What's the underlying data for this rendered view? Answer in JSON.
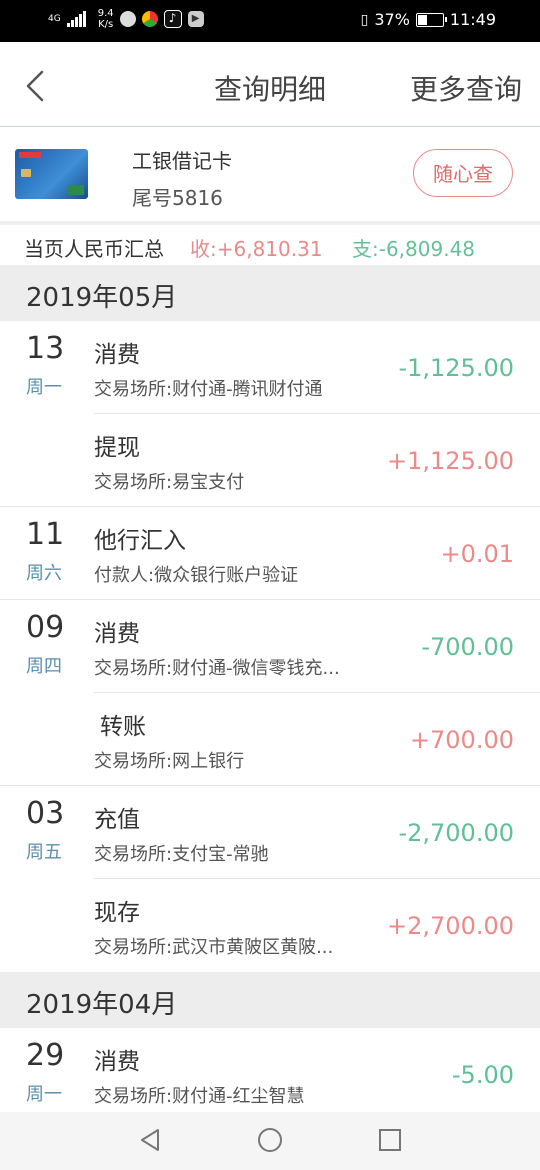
{
  "status": {
    "network": "4G",
    "speed_value": "9.4",
    "speed_unit": "K/s",
    "battery": "37%",
    "time": "11:49",
    "app_icons": [
      "wechat-icon",
      "browser-icon",
      "tiktok-icon",
      "video-icon"
    ]
  },
  "nav": {
    "title": "查询明细",
    "more": "更多查询"
  },
  "card": {
    "name": "工银借记卡",
    "tail": "尾号5816",
    "button": "随心查"
  },
  "summary": {
    "label": "当页人民币汇总",
    "income": "收:+6,810.31",
    "expense": "支:-6,809.48"
  },
  "months": [
    {
      "label": "2019年05月"
    },
    {
      "label": "2019年04月"
    }
  ],
  "transactions": [
    {
      "day": "13",
      "weekday": "周一",
      "title": "消费",
      "desc": "交易场所:财付通-腾讯财付通",
      "amount": "-1,125.00"
    },
    {
      "day": "",
      "weekday": "",
      "title": "提现",
      "desc": "交易场所:易宝支付",
      "amount": "+1,125.00"
    },
    {
      "day": "11",
      "weekday": "周六",
      "title": "他行汇入",
      "desc": "付款人:微众银行账户验证",
      "amount": "+0.01"
    },
    {
      "day": "09",
      "weekday": "周四",
      "title": "消费",
      "desc": "交易场所:财付通-微信零钱充...",
      "amount": "-700.00"
    },
    {
      "day": "",
      "weekday": "",
      "title": "转账",
      "desc": "交易场所:网上银行",
      "amount": "+700.00"
    },
    {
      "day": "03",
      "weekday": "周五",
      "title": "充值",
      "desc": "交易场所:支付宝-常驰",
      "amount": "-2,700.00"
    },
    {
      "day": "",
      "weekday": "",
      "title": "现存",
      "desc": "交易场所:武汉市黄陂区黄陂...",
      "amount": "+2,700.00"
    },
    {
      "day": "29",
      "weekday": "周一",
      "title": "消费",
      "desc": "交易场所:财付通-红尘智慧",
      "amount": "-5.00"
    }
  ],
  "colors": {
    "income": "#ec8a8a",
    "expense": "#5fbf95",
    "weekday": "#5a90ad"
  }
}
